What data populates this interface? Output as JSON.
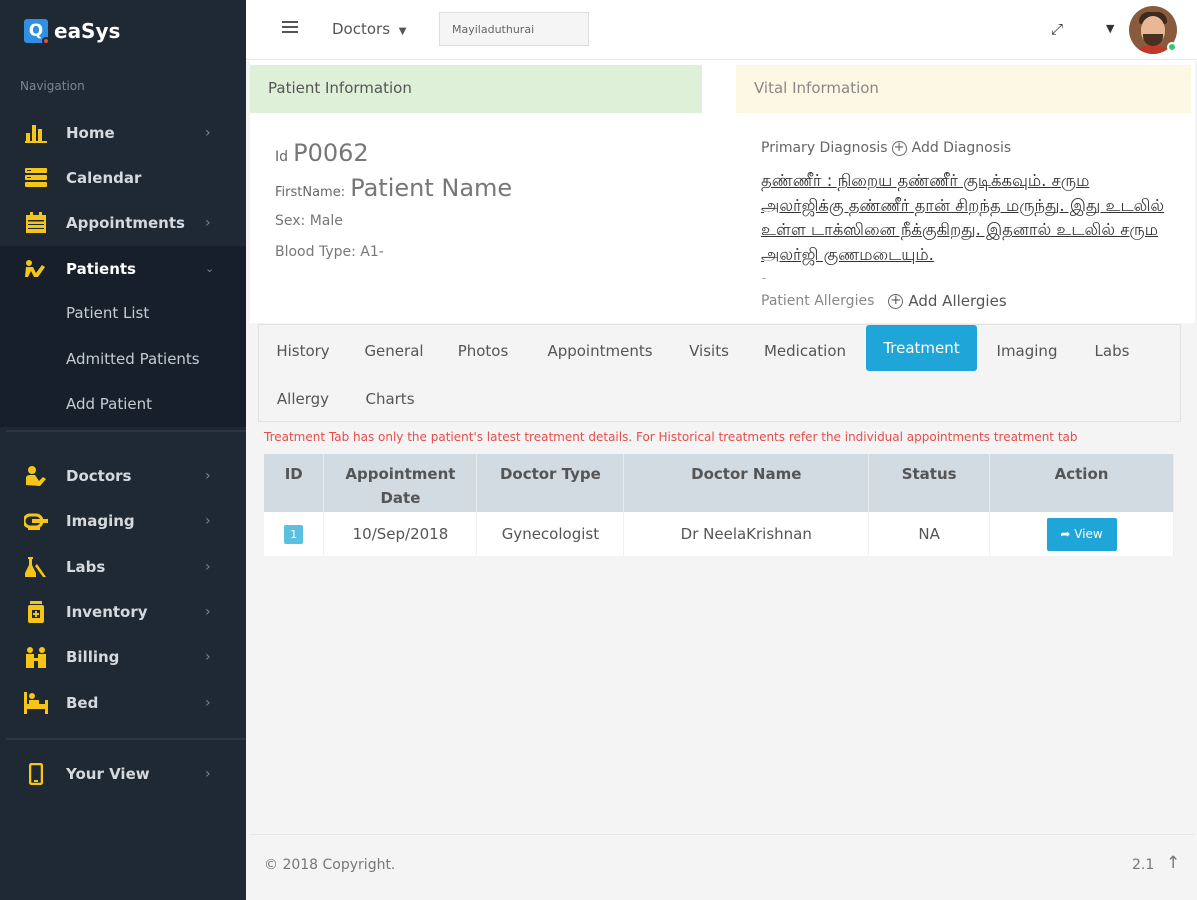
{
  "app": {
    "name": "eaSys"
  },
  "sidebar": {
    "heading": "Navigation",
    "items": [
      {
        "label": "Home",
        "icon": "bar-chart-icon"
      },
      {
        "label": "Calendar",
        "icon": "calendar-stack-icon"
      },
      {
        "label": "Appointments",
        "icon": "calendar-icon"
      },
      {
        "label": "Patients",
        "icon": "patient-bed-icon"
      },
      {
        "label": "Doctors",
        "icon": "doctor-icon"
      },
      {
        "label": "Imaging",
        "icon": "imaging-icon"
      },
      {
        "label": "Labs",
        "icon": "labs-icon"
      },
      {
        "label": "Inventory",
        "icon": "inventory-icon"
      },
      {
        "label": "Billing",
        "icon": "billing-icon"
      },
      {
        "label": "Bed",
        "icon": "bed-icon"
      },
      {
        "label": "Your View",
        "icon": "mobile-icon"
      }
    ],
    "sub_items": [
      "Patient List",
      "Admitted Patients",
      "Add Patient"
    ],
    "accent_color": "#f5c518"
  },
  "topbar": {
    "doctors_label": "Doctors",
    "location_value": "Mayiladuthurai"
  },
  "patient_info": {
    "header": "Patient Information",
    "id_label": "Id",
    "id_value": "P0062",
    "first_name_label": "FirstName:",
    "first_name_value": "Patient Name",
    "sex": "Sex: Male",
    "blood_type": "Blood Type: A1-"
  },
  "vital_info": {
    "header": "Vital Information",
    "primary_diagnosis_label": "Primary Diagnosis",
    "add_diagnosis_label": "Add Diagnosis",
    "diagnosis_text": "தண்ணீர் : நிறைய தண்ணீர் குடிக்கவும். சரும அலர்ஜிக்கு தண்ணீர் தான் சிறந்த மருந்து. இது உடலில் உள்ள டாக்ஸினை நீக்குகிறது. இதனால் உடலில் சரும அலர்ஜி குணமடையும்.",
    "dash_mark": "-",
    "allergies_label": "Patient Allergies",
    "add_allergies_label": "Add Allergies"
  },
  "tabs": [
    "History",
    "General",
    "Photos",
    "Appointments",
    "Visits",
    "Medication",
    "Treatment",
    "Imaging",
    "Labs",
    "Allergy",
    "Charts"
  ],
  "active_tab": "Treatment",
  "notice": "Treatment Tab has only the patient's latest treatment details. For Historical treatments refer the individual appointments treatment tab",
  "table": {
    "headers": [
      "ID",
      "Appointment Date",
      "Doctor Type",
      "Doctor Name",
      "Status",
      "Action"
    ],
    "rows": [
      {
        "id": "1",
        "date": "10/Sep/2018",
        "doctor_type": "Gynecologist",
        "doctor_name": "Dr NeelaKrishnan",
        "status": "NA",
        "action": "View"
      }
    ]
  },
  "footer": {
    "copyright": "© 2018 Copyright.",
    "version": "2.1"
  }
}
